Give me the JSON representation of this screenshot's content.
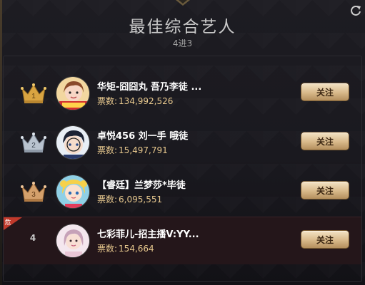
{
  "header": {
    "title": "最佳综合艺人",
    "subtitle": "4进3"
  },
  "colors": {
    "gold": "#e6c78d",
    "danger": "#c0392b",
    "button_gradient_top": "#f4e3c5",
    "button_gradient_bottom": "#b48f5d"
  },
  "rows": [
    {
      "rank": "1",
      "rank_style": "gold-crown",
      "name": "华矩-囧囧丸 吾乃李徒 ...",
      "votes_label": "票数:",
      "votes": "134,992,526",
      "follow_label": "关注",
      "avatar_icon": "girl-avatar-icon"
    },
    {
      "rank": "2",
      "rank_style": "silver-crown",
      "name": "卓悦456 刘一手 哦徒",
      "votes_label": "票数:",
      "votes": "15,497,791",
      "follow_label": "关注",
      "avatar_icon": "anime-boy-avatar-icon"
    },
    {
      "rank": "3",
      "rank_style": "bronze-crown",
      "name": "【睿廷】兰梦莎*毕徒",
      "votes_label": "票数:",
      "votes": "6,095,551",
      "follow_label": "关注",
      "avatar_icon": "sailor-moon-avatar-icon"
    },
    {
      "rank": "4",
      "rank_style": "plain",
      "danger_label": "危",
      "name": "七彩菲儿-招主播V:YY...",
      "votes_label": "票数:",
      "votes": "154,664",
      "follow_label": "关注",
      "avatar_icon": "woman-avatar-icon"
    }
  ]
}
